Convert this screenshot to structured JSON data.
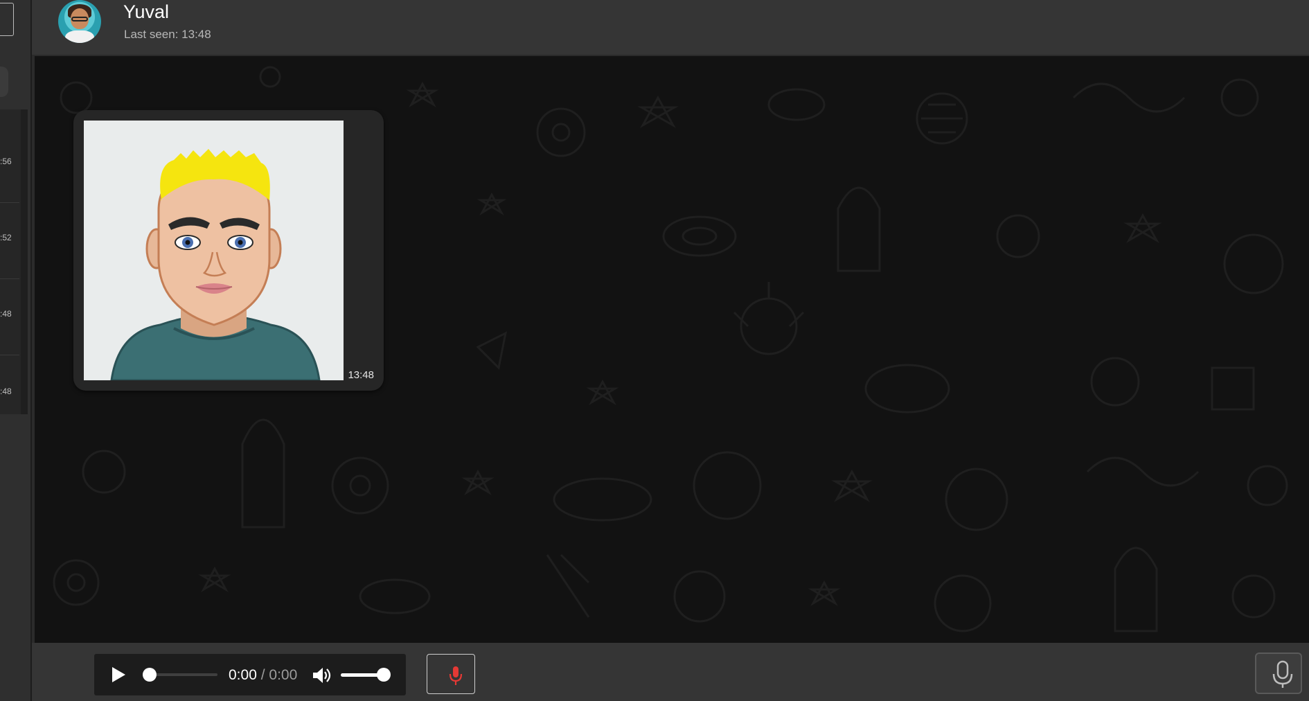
{
  "sidebar": {
    "items": [
      {
        "time": ":56"
      },
      {
        "time": ":52"
      },
      {
        "time": ":48"
      },
      {
        "time": ":48"
      }
    ]
  },
  "header": {
    "contact_name": "Yuval",
    "last_seen": "Last seen: 13:48",
    "avatar_icon": "user-avatar-icon"
  },
  "messages": [
    {
      "type": "image",
      "time": "13:48"
    }
  ],
  "audio_player": {
    "current_time": "0:00",
    "separator": " / ",
    "duration": "0:00",
    "progress": 0,
    "volume": 1
  },
  "colors": {
    "header_bg": "#353535",
    "chat_bg": "#121212",
    "bubble_bg": "#262626",
    "record_accent": "#e53935",
    "text_primary": "#ffffff",
    "text_secondary": "#b8b8b8"
  }
}
